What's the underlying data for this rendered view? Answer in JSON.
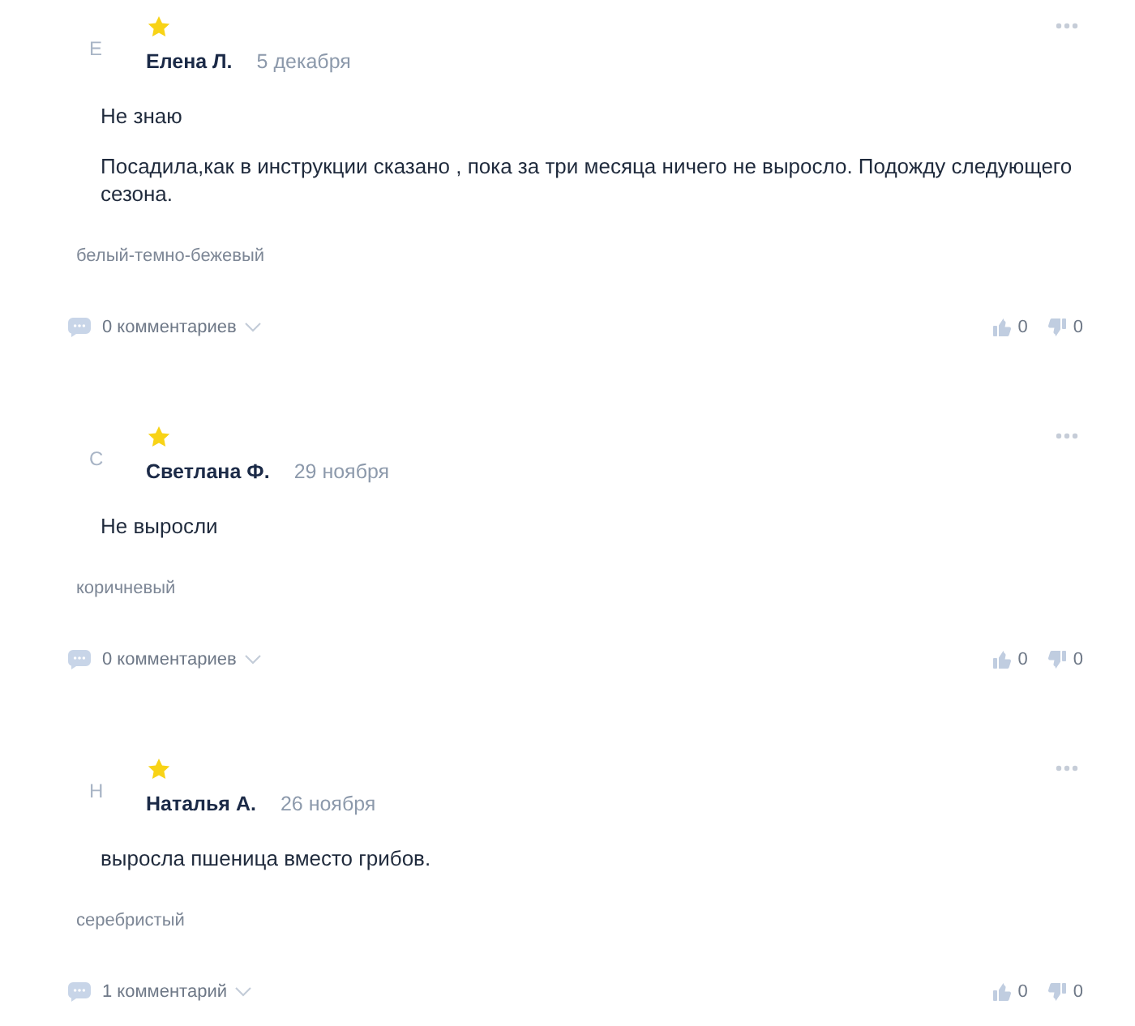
{
  "reviews": [
    {
      "avatar": "Е",
      "author": "Елена Л.",
      "date": "5 декабря",
      "paragraphs": [
        "Не знаю",
        "Посадила,как в инструкции сказано , пока за три месяца ничего не выросло. Подожду следующего сезона."
      ],
      "variant": "белый-темно-бежевый",
      "comments": "0 комментариев",
      "likes": "0",
      "dislikes": "0"
    },
    {
      "avatar": "С",
      "author": "Светлана Ф.",
      "date": "29 ноября",
      "paragraphs": [
        "Не выросли"
      ],
      "variant": "коричневый",
      "comments": "0 комментариев",
      "likes": "0",
      "dislikes": "0"
    },
    {
      "avatar": "Н",
      "author": "Наталья А.",
      "date": "26 ноября",
      "paragraphs": [
        "выросла пшеница вместо грибов."
      ],
      "variant": "серебристый",
      "comments": "1 комментарий",
      "likes": "0",
      "dislikes": "0"
    }
  ]
}
